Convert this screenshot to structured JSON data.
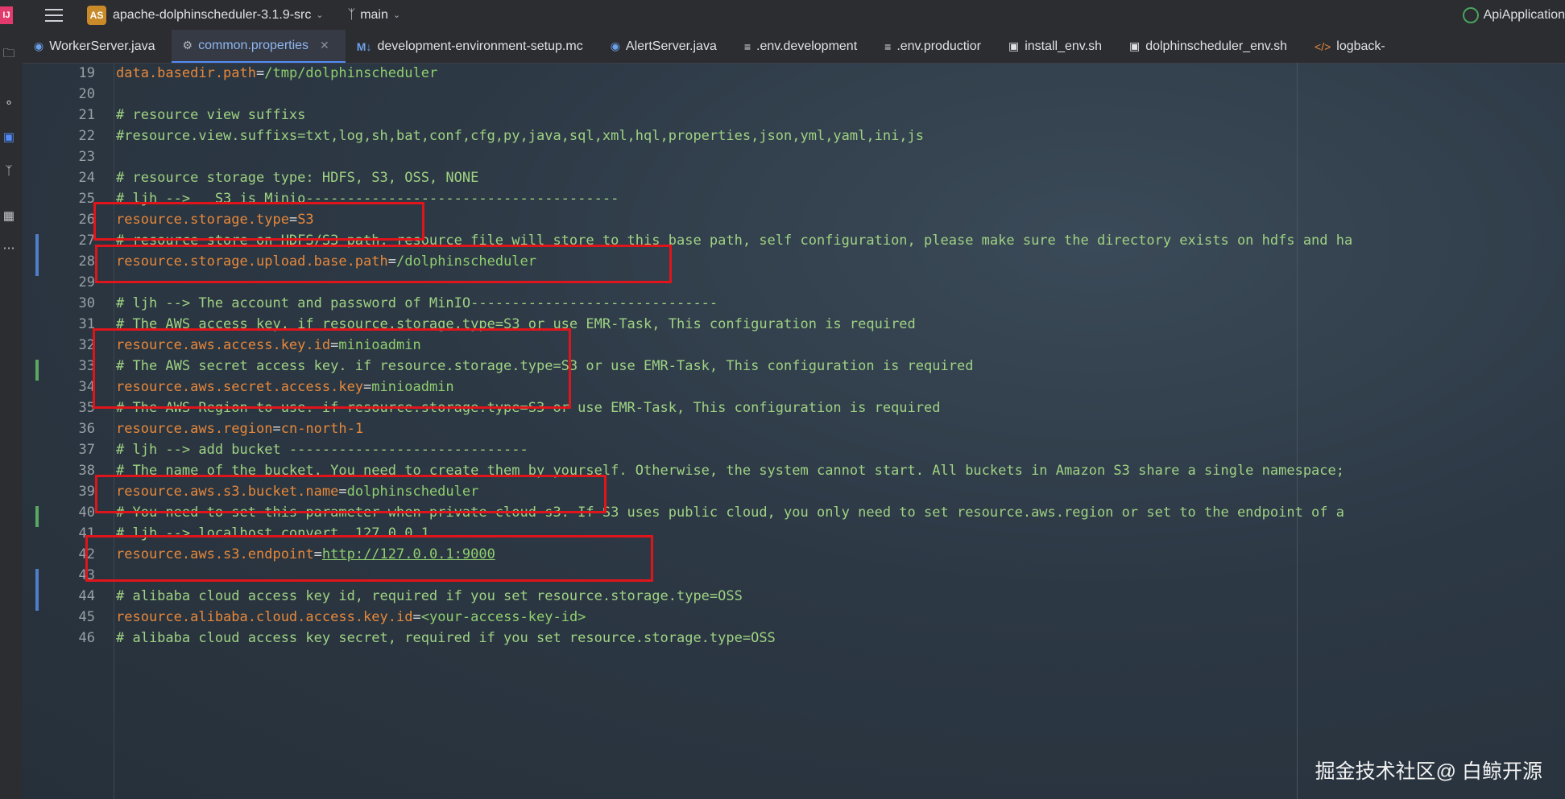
{
  "titlebar": {
    "app_icon": "IJ",
    "project_badge": "AS",
    "project_name": "apache-dolphinscheduler-3.1.9-src",
    "branch": "main",
    "run_config": "ApiApplication"
  },
  "tabs": [
    {
      "label": "WorkerServer.java",
      "icon": "java-class-icon",
      "active": false
    },
    {
      "label": "common.properties",
      "icon": "gear-icon",
      "active": true
    },
    {
      "label": "development-environment-setup.mc",
      "icon": "markdown-icon",
      "active": false
    },
    {
      "label": "AlertServer.java",
      "icon": "java-class-icon",
      "active": false
    },
    {
      "label": ".env.development",
      "icon": "text-file-icon",
      "active": false
    },
    {
      "label": ".env.productior",
      "icon": "text-file-icon",
      "active": false
    },
    {
      "label": "install_env.sh",
      "icon": "shell-icon",
      "active": false
    },
    {
      "label": "dolphinscheduler_env.sh",
      "icon": "shell-icon",
      "active": false
    },
    {
      "label": "logback-",
      "icon": "xml-icon",
      "active": false
    }
  ],
  "editor": {
    "lines": [
      {
        "num": "19",
        "key": "data.basedir.path",
        "value": "/tmp/dolphinscheduler"
      },
      {
        "num": "20"
      },
      {
        "num": "21",
        "comment": "# resource view suffixs"
      },
      {
        "num": "22",
        "comment": "#resource.view.suffixs=txt,log,sh,bat,conf,cfg,py,java,sql,xml,hql,properties,json,yml,yaml,ini,js"
      },
      {
        "num": "23"
      },
      {
        "num": "24",
        "comment": "# resource storage type: HDFS, S3, OSS, NONE"
      },
      {
        "num": "25",
        "comment": "# ljh -->   S3 is Minio--------------------------------------"
      },
      {
        "num": "26",
        "key": "resource.storage.type",
        "value": "S3"
      },
      {
        "num": "27",
        "comment": "# resource store on HDFS/S3 path, resource file will store to this base path, self configuration, please make sure the directory exists on hdfs and ha"
      },
      {
        "num": "28",
        "key": "resource.storage.upload.base.path",
        "value": "/dolphinscheduler"
      },
      {
        "num": "29"
      },
      {
        "num": "30",
        "comment": "# ljh --> The account and password of MinIO------------------------------"
      },
      {
        "num": "31",
        "comment": "# The AWS access key. if resource.storage.type=S3 or use EMR-Task, This configuration is required"
      },
      {
        "num": "32",
        "key": "resource.aws.access.key.id",
        "value": "minioadmin"
      },
      {
        "num": "33",
        "comment": "# The AWS secret access key. if resource.storage.type=S3 or use EMR-Task, This configuration is required"
      },
      {
        "num": "34",
        "key": "resource.aws.secret.access.key",
        "value": "minioadmin"
      },
      {
        "num": "35",
        "comment": "# The AWS Region to use. if resource.storage.type=S3 or use EMR-Task, This configuration is required"
      },
      {
        "num": "36",
        "key": "resource.aws.region",
        "value": "cn-north-1"
      },
      {
        "num": "37",
        "comment": "# ljh --> add bucket -----------------------------"
      },
      {
        "num": "38",
        "comment": "# The name of the bucket. You need to create them by yourself. Otherwise, the system cannot start. All buckets in Amazon S3 share a single namespace;"
      },
      {
        "num": "39",
        "key": "resource.aws.s3.bucket.name",
        "value": "dolphinscheduler"
      },
      {
        "num": "40",
        "comment": "# You need to set this parameter when private cloud s3. If S3 uses public cloud, you only need to set resource.aws.region or set to the endpoint of a"
      },
      {
        "num": "41",
        "comment": "# ljh --> localhost convert  127.0.0.1"
      },
      {
        "num": "42",
        "key": "resource.aws.s3.endpoint",
        "value": "http://127.0.0.1:9000"
      },
      {
        "num": "43"
      },
      {
        "num": "44",
        "comment": "# alibaba cloud access key id, required if you set resource.storage.type=OSS"
      },
      {
        "num": "45",
        "key": "resource.alibaba.cloud.access.key.id",
        "value": "<your-access-key-id>"
      },
      {
        "num": "46",
        "comment": "# alibaba cloud access key secret, required if you set resource.storage.type=OSS"
      }
    ]
  },
  "watermark": "掘金技术社区@ 白鲸开源",
  "colors": {
    "property_key": "#e8883a",
    "property_value": "#8fce6e",
    "comment": "#9fd283",
    "highlight_box": "#e0141b",
    "active_tab": "#8fb6f0"
  }
}
